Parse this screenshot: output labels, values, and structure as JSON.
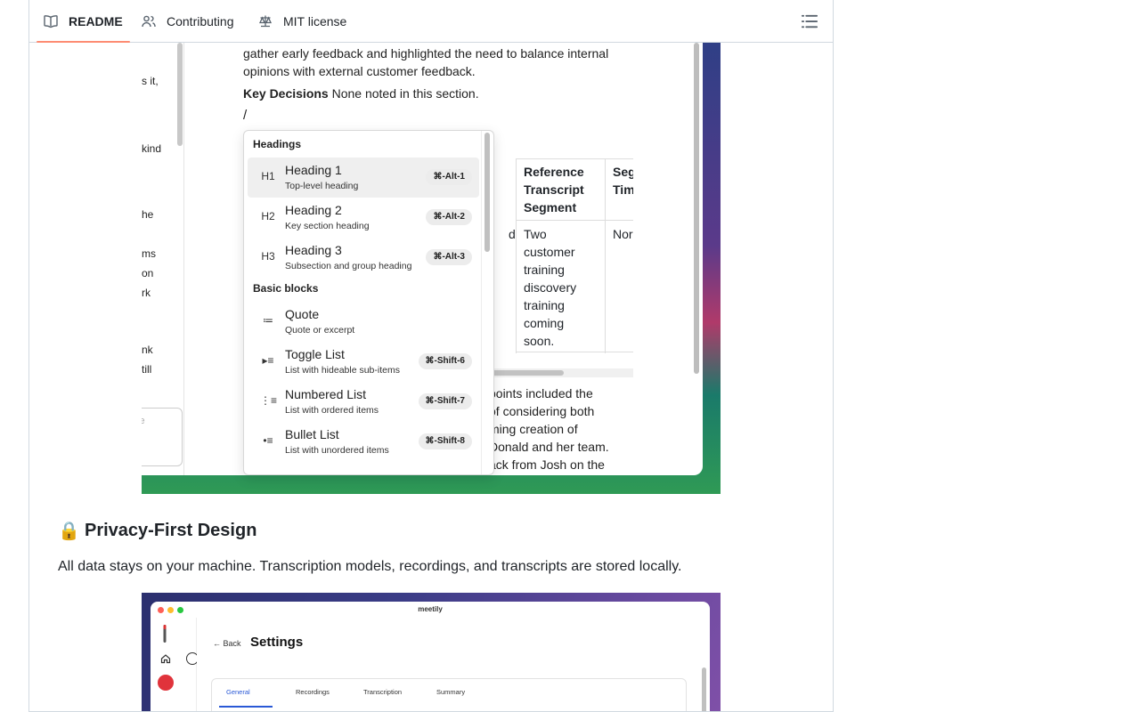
{
  "tabs": [
    {
      "label": "README",
      "icon": "book-icon",
      "active": true
    },
    {
      "label": "Contributing",
      "icon": "people-icon",
      "active": false
    },
    {
      "label": "MIT license",
      "icon": "law-icon",
      "active": false
    }
  ],
  "toc_icon": "list-icon",
  "screenshot1": {
    "left_fragments": [
      "s it,",
      "kind",
      "he",
      "ms",
      "on",
      "rk",
      "nk",
      "till"
    ],
    "chat_placeholder": "le",
    "doc_paragraph": "gather early feedback and highlighted the need to balance internal opinions with external customer feedback.",
    "key_decisions_label": "Key Decisions",
    "key_decisions_text": "None noted in this section.",
    "slash": "/",
    "table": {
      "col1_body": "d",
      "col2_header": "Reference Transcript Segment",
      "col2_body": "Two customer training discovery training coming soon.",
      "col3_header": "Seg Tim",
      "col3_body": "Nor"
    },
    "para_lines": [
      "points included the",
      "of considering both",
      "ming creation of",
      "Donald and her team.",
      "ack from Josh on the"
    ],
    "menu": {
      "section_headings": "Headings",
      "section_basic": "Basic blocks",
      "items": [
        {
          "icon": "H1",
          "title": "Heading 1",
          "subtitle": "Top-level heading",
          "shortcut": "⌘-Alt-1"
        },
        {
          "icon": "H2",
          "title": "Heading 2",
          "subtitle": "Key section heading",
          "shortcut": "⌘-Alt-2"
        },
        {
          "icon": "H3",
          "title": "Heading 3",
          "subtitle": "Subsection and group heading",
          "shortcut": "⌘-Alt-3"
        },
        {
          "icon": "≔",
          "title": "Quote",
          "subtitle": "Quote or excerpt",
          "shortcut": ""
        },
        {
          "icon": "▸≡",
          "title": "Toggle List",
          "subtitle": "List with hideable sub-items",
          "shortcut": "⌘-Shift-6"
        },
        {
          "icon": "⋮≡",
          "title": "Numbered List",
          "subtitle": "List with ordered items",
          "shortcut": "⌘-Shift-7"
        },
        {
          "icon": "•≡",
          "title": "Bullet List",
          "subtitle": "List with unordered items",
          "shortcut": "⌘-Shift-8"
        }
      ]
    }
  },
  "section": {
    "emoji": "🔒",
    "title": "Privacy-First Design",
    "description": "All data stays on your machine. Transcription models, recordings, and transcripts are stored locally."
  },
  "screenshot2": {
    "app_title": "meetily",
    "back_label": "Back",
    "page_title": "Settings",
    "tabs": [
      "General",
      "Recordings",
      "Transcription",
      "Summary"
    ]
  },
  "colors": {
    "tab_underline": "#fd8c73",
    "border": "#d1d9e0",
    "accent_blue": "#2a59d6"
  }
}
